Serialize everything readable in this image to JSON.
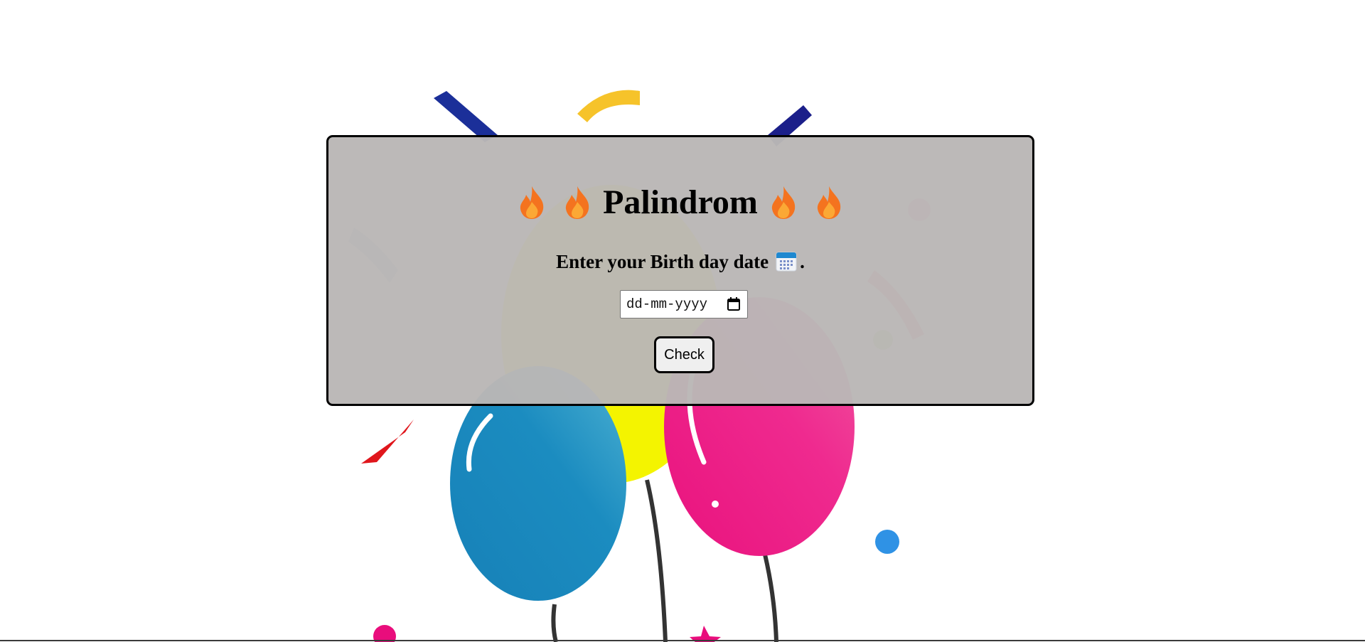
{
  "header": {
    "title": "Palindrom",
    "flame_icon": "fire-emoji-icon"
  },
  "form": {
    "prompt": "Enter your Birth day date",
    "prompt_suffix": ".",
    "calendar_icon": "calendar-emoji-icon",
    "date_placeholder": "dd-mm-yyyy",
    "check_label": "Check"
  },
  "colors": {
    "card_background": "#bab7b6",
    "card_border": "#000000",
    "button_background": "#efefef",
    "flame_outer": "#f4731f",
    "flame_inner": "#fba835"
  }
}
